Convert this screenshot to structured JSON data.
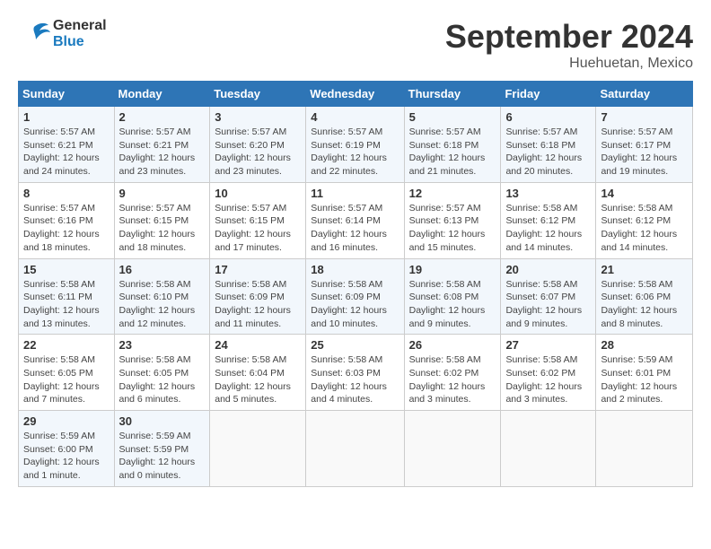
{
  "header": {
    "logo_line1": "General",
    "logo_line2": "Blue",
    "month": "September 2024",
    "location": "Huehuetan, Mexico"
  },
  "columns": [
    "Sunday",
    "Monday",
    "Tuesday",
    "Wednesday",
    "Thursday",
    "Friday",
    "Saturday"
  ],
  "weeks": [
    [
      {
        "day": "1",
        "sunrise": "5:57 AM",
        "sunset": "6:21 PM",
        "daylight": "12 hours and 24 minutes."
      },
      {
        "day": "2",
        "sunrise": "5:57 AM",
        "sunset": "6:21 PM",
        "daylight": "12 hours and 23 minutes."
      },
      {
        "day": "3",
        "sunrise": "5:57 AM",
        "sunset": "6:20 PM",
        "daylight": "12 hours and 23 minutes."
      },
      {
        "day": "4",
        "sunrise": "5:57 AM",
        "sunset": "6:19 PM",
        "daylight": "12 hours and 22 minutes."
      },
      {
        "day": "5",
        "sunrise": "5:57 AM",
        "sunset": "6:18 PM",
        "daylight": "12 hours and 21 minutes."
      },
      {
        "day": "6",
        "sunrise": "5:57 AM",
        "sunset": "6:18 PM",
        "daylight": "12 hours and 20 minutes."
      },
      {
        "day": "7",
        "sunrise": "5:57 AM",
        "sunset": "6:17 PM",
        "daylight": "12 hours and 19 minutes."
      }
    ],
    [
      {
        "day": "8",
        "sunrise": "5:57 AM",
        "sunset": "6:16 PM",
        "daylight": "12 hours and 18 minutes."
      },
      {
        "day": "9",
        "sunrise": "5:57 AM",
        "sunset": "6:15 PM",
        "daylight": "12 hours and 18 minutes."
      },
      {
        "day": "10",
        "sunrise": "5:57 AM",
        "sunset": "6:15 PM",
        "daylight": "12 hours and 17 minutes."
      },
      {
        "day": "11",
        "sunrise": "5:57 AM",
        "sunset": "6:14 PM",
        "daylight": "12 hours and 16 minutes."
      },
      {
        "day": "12",
        "sunrise": "5:57 AM",
        "sunset": "6:13 PM",
        "daylight": "12 hours and 15 minutes."
      },
      {
        "day": "13",
        "sunrise": "5:58 AM",
        "sunset": "6:12 PM",
        "daylight": "12 hours and 14 minutes."
      },
      {
        "day": "14",
        "sunrise": "5:58 AM",
        "sunset": "6:12 PM",
        "daylight": "12 hours and 14 minutes."
      }
    ],
    [
      {
        "day": "15",
        "sunrise": "5:58 AM",
        "sunset": "6:11 PM",
        "daylight": "12 hours and 13 minutes."
      },
      {
        "day": "16",
        "sunrise": "5:58 AM",
        "sunset": "6:10 PM",
        "daylight": "12 hours and 12 minutes."
      },
      {
        "day": "17",
        "sunrise": "5:58 AM",
        "sunset": "6:09 PM",
        "daylight": "12 hours and 11 minutes."
      },
      {
        "day": "18",
        "sunrise": "5:58 AM",
        "sunset": "6:09 PM",
        "daylight": "12 hours and 10 minutes."
      },
      {
        "day": "19",
        "sunrise": "5:58 AM",
        "sunset": "6:08 PM",
        "daylight": "12 hours and 9 minutes."
      },
      {
        "day": "20",
        "sunrise": "5:58 AM",
        "sunset": "6:07 PM",
        "daylight": "12 hours and 9 minutes."
      },
      {
        "day": "21",
        "sunrise": "5:58 AM",
        "sunset": "6:06 PM",
        "daylight": "12 hours and 8 minutes."
      }
    ],
    [
      {
        "day": "22",
        "sunrise": "5:58 AM",
        "sunset": "6:05 PM",
        "daylight": "12 hours and 7 minutes."
      },
      {
        "day": "23",
        "sunrise": "5:58 AM",
        "sunset": "6:05 PM",
        "daylight": "12 hours and 6 minutes."
      },
      {
        "day": "24",
        "sunrise": "5:58 AM",
        "sunset": "6:04 PM",
        "daylight": "12 hours and 5 minutes."
      },
      {
        "day": "25",
        "sunrise": "5:58 AM",
        "sunset": "6:03 PM",
        "daylight": "12 hours and 4 minutes."
      },
      {
        "day": "26",
        "sunrise": "5:58 AM",
        "sunset": "6:02 PM",
        "daylight": "12 hours and 3 minutes."
      },
      {
        "day": "27",
        "sunrise": "5:58 AM",
        "sunset": "6:02 PM",
        "daylight": "12 hours and 3 minutes."
      },
      {
        "day": "28",
        "sunrise": "5:59 AM",
        "sunset": "6:01 PM",
        "daylight": "12 hours and 2 minutes."
      }
    ],
    [
      {
        "day": "29",
        "sunrise": "5:59 AM",
        "sunset": "6:00 PM",
        "daylight": "12 hours and 1 minute."
      },
      {
        "day": "30",
        "sunrise": "5:59 AM",
        "sunset": "5:59 PM",
        "daylight": "12 hours and 0 minutes."
      },
      null,
      null,
      null,
      null,
      null
    ]
  ]
}
